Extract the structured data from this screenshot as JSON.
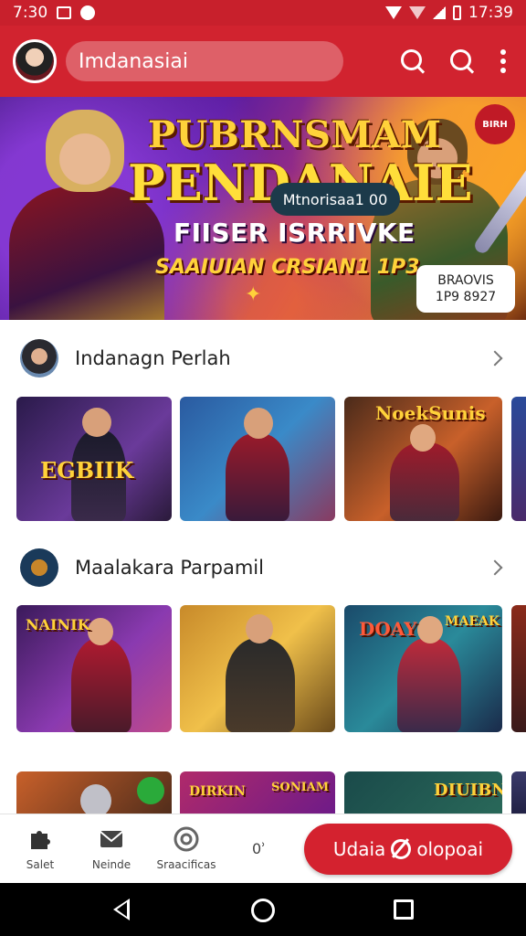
{
  "status_bar": {
    "time_left": "7:30",
    "time_right": "17:39"
  },
  "app_bar": {
    "title": "Imdanasiai"
  },
  "banner": {
    "title_line1": "PUBRNSMAM",
    "title_line2": "PENDANAIE",
    "subtitle": "FIISER ISRRIVKE",
    "tagline": "SAAIUIAN CRSIAN1 1P3",
    "pill_text": "Mtnorisaa1 00",
    "card_line1": "BRAOVIS",
    "card_line2": "1P9 8927",
    "badge_text": "BIRH"
  },
  "section1": {
    "title": "Indanagn Perlah"
  },
  "row1": {
    "card1_label": "EGBIIK",
    "card3_label": "NoekSunis"
  },
  "section2": {
    "title": "Maalakara Parpamil"
  },
  "row2": {
    "card1_label": "NAINIK",
    "card3_label": "DOAY",
    "card3_label2": "MAEAK"
  },
  "row3": {
    "card2_label": "DIRKIN",
    "card2_label2": "SONIAM",
    "card4_label": "DIUIBN"
  },
  "bottom_nav": {
    "items": [
      {
        "label": "Salet",
        "icon": "puzzle-icon"
      },
      {
        "label": "Neinde",
        "icon": "mail-icon"
      },
      {
        "label": "Sraacificas",
        "icon": "target-icon"
      }
    ],
    "extra": "0ʾ",
    "cta_label_left": "Udaia",
    "cta_label_right": "olopoai"
  },
  "colors": {
    "brand_red": "#d1232f",
    "status_red": "#c8202c"
  }
}
